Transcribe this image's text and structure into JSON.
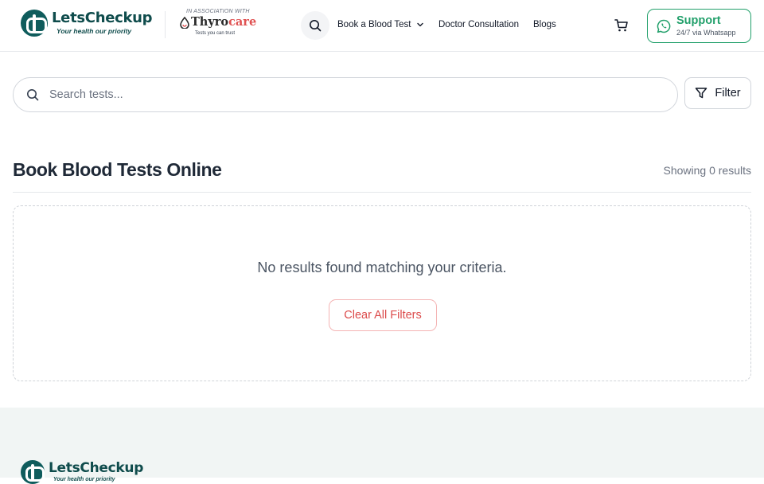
{
  "header": {
    "brand_name": "LetsCheckup",
    "brand_tagline": "Your health our priority",
    "partner_assoc": "IN ASSOCIATION WITH",
    "partner_name_a": "Thyro",
    "partner_name_b": "care",
    "partner_tagline": "Tests you can trust",
    "nav": {
      "book": "Book a Blood Test",
      "doctor": "Doctor Consultation",
      "blogs": "Blogs"
    },
    "support_title": "Support",
    "support_sub": "24/7 via Whatsapp"
  },
  "search": {
    "placeholder": "Search tests...",
    "filter_label": "Filter"
  },
  "main": {
    "title": "Book Blood Tests Online",
    "results": "Showing 0 results",
    "empty_message": "No results found matching your criteria.",
    "clear_label": "Clear All Filters"
  },
  "footer": {
    "brand_name": "LetsCheckup",
    "brand_tagline": "Your health our priority"
  },
  "colors": {
    "brand": "#0f4c4c",
    "support_green": "#22a06b",
    "clear_red": "#dc4b4b",
    "footer_bg": "#f1f5f4"
  },
  "icons": {
    "search": "search-icon",
    "chevron": "chevron-down-icon",
    "cart": "cart-icon",
    "whatsapp": "whatsapp-icon",
    "filter": "filter-icon"
  }
}
